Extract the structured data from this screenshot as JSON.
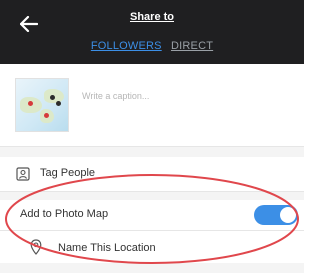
{
  "header": {
    "title": "Share to",
    "tabs": [
      {
        "label": "FOLLOWERS",
        "active": true
      },
      {
        "label": "DIRECT",
        "active": false
      }
    ],
    "back_icon": "arrow-left-icon"
  },
  "caption": {
    "placeholder": "Write a caption..."
  },
  "tag_people": {
    "label": "Tag People",
    "icon": "tag-person-icon"
  },
  "photo_map": {
    "label": "Add to Photo Map",
    "enabled": true
  },
  "location": {
    "label": "Name This Location",
    "icon": "location-pin-icon"
  },
  "colors": {
    "header_bg": "#1f1f21",
    "accent": "#3c8fe6",
    "annotation": "#e0474c"
  }
}
